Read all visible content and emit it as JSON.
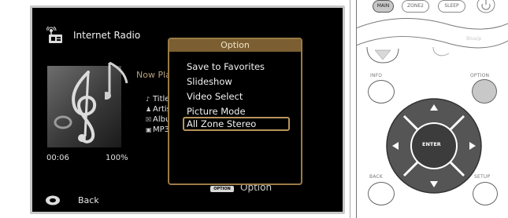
{
  "screen": {
    "source_title": "Internet Radio",
    "now_playing": "Now Pla",
    "meta": [
      {
        "icon": "note-icon",
        "text": "Title"
      },
      {
        "icon": "person-icon",
        "text": "Artist"
      },
      {
        "icon": "album-icon",
        "text": "Albur"
      },
      {
        "icon": "format-icon",
        "text": "MP3"
      }
    ],
    "time_elapsed": "00:06",
    "progress": "100%",
    "back_label": "Back",
    "option_button_label": "OPTION",
    "option_label": "Option"
  },
  "popup": {
    "title": "Option",
    "items": [
      "Save to Favorites",
      "Slideshow",
      "Video Select",
      "Picture Mode",
      "All Zone Stereo"
    ],
    "selected": "All Zone Stereo"
  },
  "remote": {
    "top_buttons": [
      "MAIN",
      "ZONE2",
      "SLEEP"
    ],
    "faded_label": "Blue/p",
    "info_label": "INFO",
    "option_label": "OPTION",
    "back_label": "BACK",
    "setup_label": "SETUP",
    "enter_label": "ENTER"
  },
  "colors": {
    "popup_border": "#9a7a45",
    "popup_title_bg": "#7b5f32",
    "highlight": "#b8955a",
    "dpad": "#5a5a5a",
    "option_button": "#c8c8c8"
  }
}
